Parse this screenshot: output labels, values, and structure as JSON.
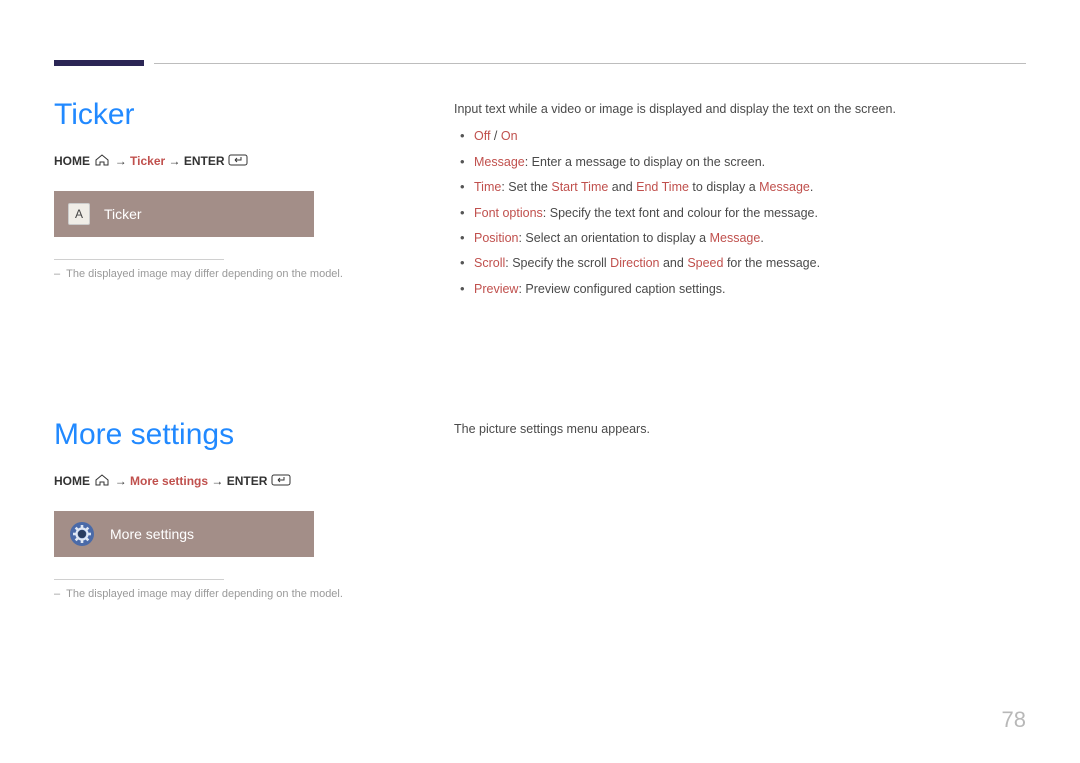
{
  "page_number": "78",
  "section1": {
    "title": "Ticker",
    "path": {
      "home": "HOME",
      "arrow": "→",
      "item": "Ticker",
      "enter": "ENTER"
    },
    "card": {
      "badge": "A",
      "label": "Ticker"
    },
    "footnote_dash": "‒",
    "footnote": "The displayed image may differ depending on the model.",
    "intro": "Input text while a video or image is displayed and display the text on the screen.",
    "bullets": {
      "b1_off": "Off",
      "b1_sep": " / ",
      "b1_on": "On",
      "b2_key": "Message",
      "b2_rest": ": Enter a message to display on the screen.",
      "b3_key": "Time",
      "b3_a": ": Set the ",
      "b3_s": "Start Time",
      "b3_b": " and ",
      "b3_e": "End Time",
      "b3_c": " to display a ",
      "b3_m": "Message",
      "b3_d": ".",
      "b4_key": "Font options",
      "b4_rest": ": Specify the text font and colour for the message.",
      "b5_key": "Position",
      "b5_a": ": Select an orientation to display a ",
      "b5_m": "Message",
      "b5_b": ".",
      "b6_key": "Scroll",
      "b6_a": ": Specify the scroll ",
      "b6_d": "Direction",
      "b6_b": " and ",
      "b6_s": "Speed",
      "b6_c": " for the message.",
      "b7_key": "Preview",
      "b7_rest": ": Preview configured caption settings."
    }
  },
  "section2": {
    "title": "More settings",
    "path": {
      "home": "HOME",
      "arrow": "→",
      "item": "More settings",
      "enter": "ENTER"
    },
    "card": {
      "label": "More settings"
    },
    "footnote_dash": "‒",
    "footnote": "The displayed image may differ depending on the model.",
    "intro": "The picture settings menu appears."
  }
}
